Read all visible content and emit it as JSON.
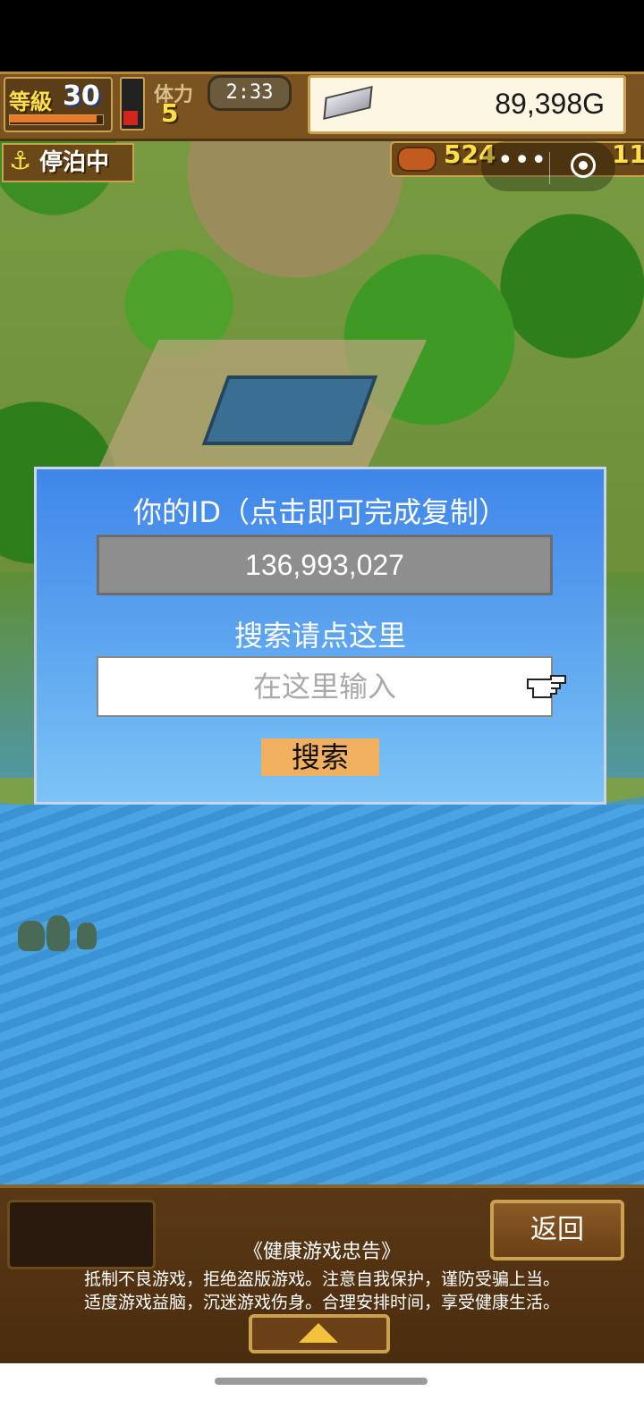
{
  "hud": {
    "level_label": "等級",
    "level_value": "30",
    "xp_fraction": 0.95,
    "stamina_label": "体力",
    "stamina_value": "5",
    "timer": "2:33",
    "gold": "89,398G",
    "docked_status": "停泊中",
    "resource_food": "524",
    "resource_wood": "11",
    "more_menu": "•••"
  },
  "dialog": {
    "title": "你的ID（点击即可完成复制）",
    "id_value": "136,993,027",
    "search_label": "搜索请点这里",
    "search_placeholder": "在这里输入",
    "search_button": "搜索"
  },
  "bottom": {
    "back_button": "返回",
    "notice_title": "《健康游戏忠告》",
    "notice_line1": "抵制不良游戏，拒绝盗版游戏。注意自我保护，谨防受骗上当。",
    "notice_line2": "适度游戏益脑，沉迷游戏伤身。合理安排时间，享受健康生活。"
  },
  "icons": {
    "anchor": "anchor-icon",
    "silver_ingot": "silver-ingot-icon",
    "meat": "meat-icon",
    "hand_pointer": "pointing-hand-icon",
    "up_arrow": "up-arrow-icon",
    "target": "target-icon"
  },
  "colors": {
    "dialog_top": "#3f86ea",
    "dialog_bottom": "#7cc4f5",
    "search_button_bg": "#f0b060",
    "hud_wood": "#7a5320",
    "gold_yellow": "#ffe04a"
  }
}
